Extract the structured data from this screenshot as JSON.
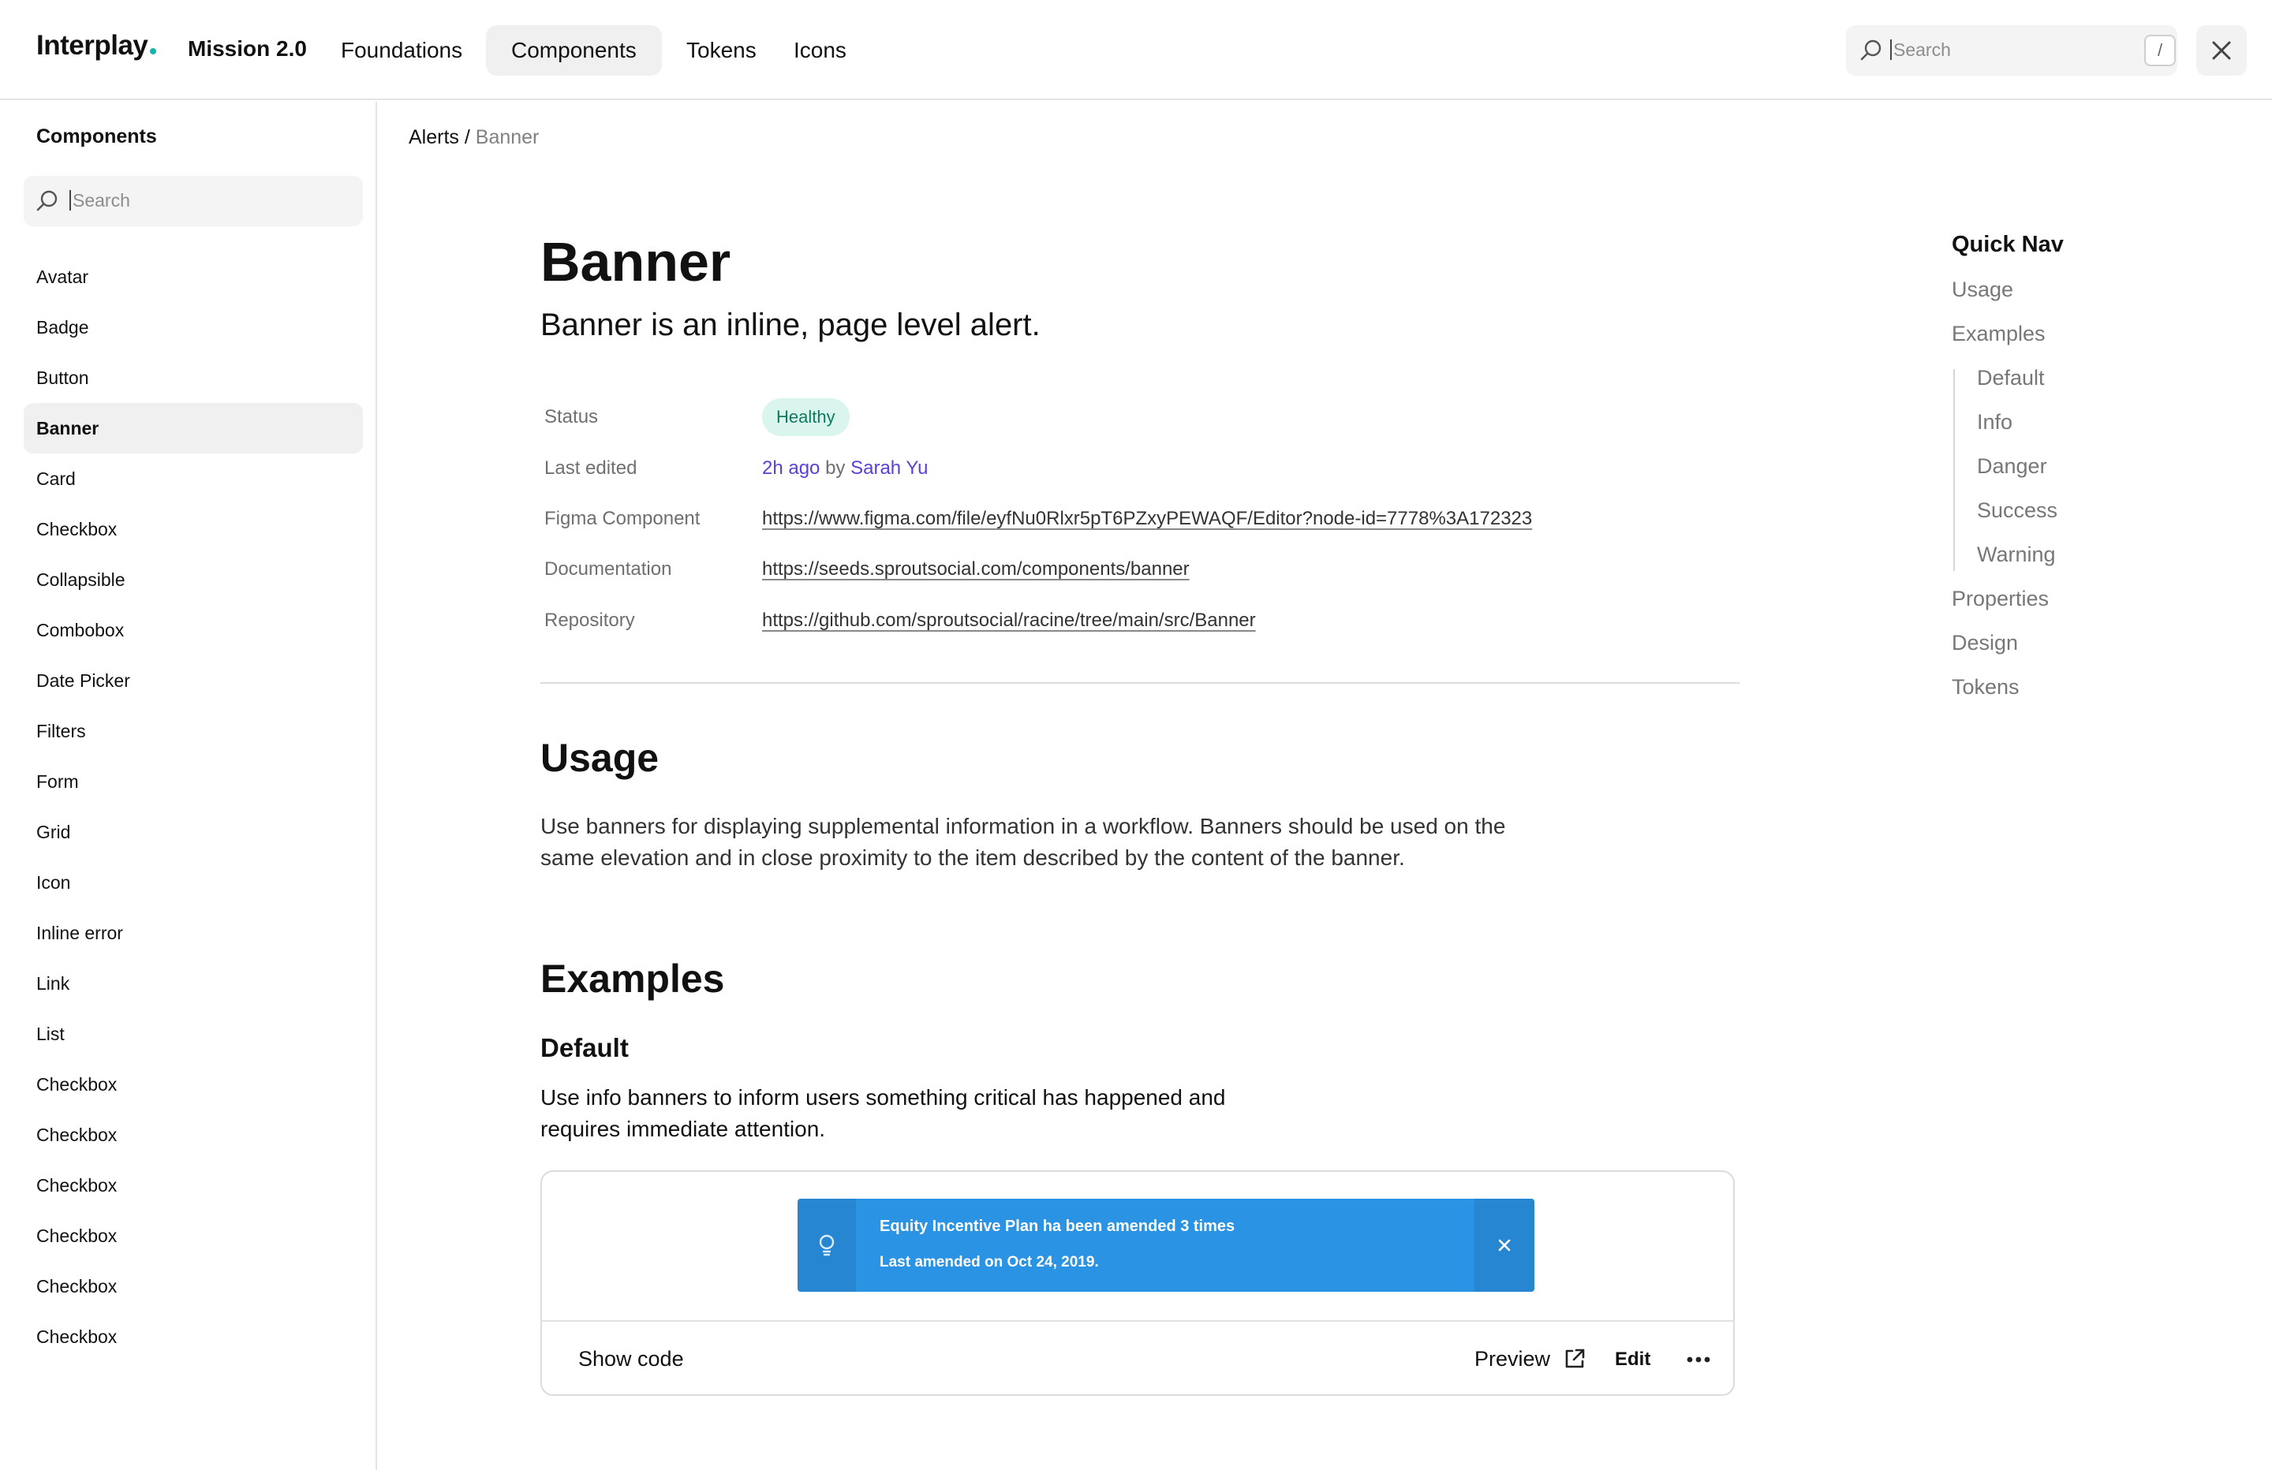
{
  "header": {
    "logo": "Interplay",
    "product": "Mission 2.0",
    "tabs": [
      {
        "label": "Foundations",
        "active": false
      },
      {
        "label": "Components",
        "active": true
      },
      {
        "label": "Tokens",
        "active": false
      },
      {
        "label": "Icons",
        "active": false
      }
    ],
    "search_placeholder": "Search",
    "search_shortcut": "/"
  },
  "sidebar": {
    "title": "Components",
    "search_placeholder": "Search",
    "items": [
      {
        "label": "Avatar",
        "active": false
      },
      {
        "label": "Badge",
        "active": false
      },
      {
        "label": "Button",
        "active": false
      },
      {
        "label": "Banner",
        "active": true
      },
      {
        "label": "Card",
        "active": false
      },
      {
        "label": "Checkbox",
        "active": false
      },
      {
        "label": "Collapsible",
        "active": false
      },
      {
        "label": "Combobox",
        "active": false
      },
      {
        "label": "Date Picker",
        "active": false
      },
      {
        "label": "Filters",
        "active": false
      },
      {
        "label": "Form",
        "active": false
      },
      {
        "label": "Grid",
        "active": false
      },
      {
        "label": "Icon",
        "active": false
      },
      {
        "label": "Inline error",
        "active": false
      },
      {
        "label": "Link",
        "active": false
      },
      {
        "label": "List",
        "active": false
      },
      {
        "label": "Checkbox",
        "active": false
      },
      {
        "label": "Checkbox",
        "active": false
      },
      {
        "label": "Checkbox",
        "active": false
      },
      {
        "label": "Checkbox",
        "active": false
      },
      {
        "label": "Checkbox",
        "active": false
      },
      {
        "label": "Checkbox",
        "active": false
      }
    ]
  },
  "breadcrumb": {
    "parent": "Alerts",
    "separator": "/",
    "current": "Banner"
  },
  "page": {
    "title": "Banner",
    "subtitle": "Banner is an inline, page level alert.",
    "meta": {
      "status_label": "Status",
      "status_value": "Healthy",
      "last_edited_label": "Last edited",
      "last_edited_time": "2h ago",
      "last_edited_by": "by",
      "last_edited_author": "Sarah Yu",
      "figma_label": "Figma Component",
      "figma_url": "https://www.figma.com/file/eyfNu0Rlxr5pT6PZxyPEWAQF/Editor?node-id=7778%3A172323",
      "docs_label": "Documentation",
      "docs_url": "https://seeds.sproutsocial.com/components/banner",
      "repo_label": "Repository",
      "repo_url": "https://github.com/sproutsocial/racine/tree/main/src/Banner"
    },
    "usage": {
      "heading": "Usage",
      "text": "Use banners for displaying supplemental information in a workflow. Banners should be used on the same elevation and in close proximity to the item described by the content of the banner."
    },
    "examples": {
      "heading": "Examples",
      "default_heading": "Default",
      "default_text": "Use info banners to inform users something critical has happened and requires immediate attention.",
      "banner_title": "Equity Incentive Plan ha been amended 3 times",
      "banner_subtitle": "Last amended on Oct 24, 2019.",
      "show_code": "Show code",
      "preview": "Preview",
      "edit": "Edit"
    }
  },
  "quick_nav": {
    "title": "Quick Nav",
    "items": [
      "Usage",
      "Examples"
    ],
    "sub_items": [
      "Default",
      "Info",
      "Danger",
      "Success",
      "Warning"
    ],
    "after_items": [
      "Properties",
      "Design",
      "Tokens"
    ]
  },
  "colors": {
    "banner_blue": "#2b93e4",
    "status_bg": "#d9f5ee",
    "status_text": "#0f7a5c",
    "link_purple": "#5b3fd8",
    "logo_dot": "#16b3ad"
  },
  "icons": [
    "search-icon",
    "close-icon",
    "lightbulb-icon",
    "external-link-icon",
    "more-icon"
  ]
}
